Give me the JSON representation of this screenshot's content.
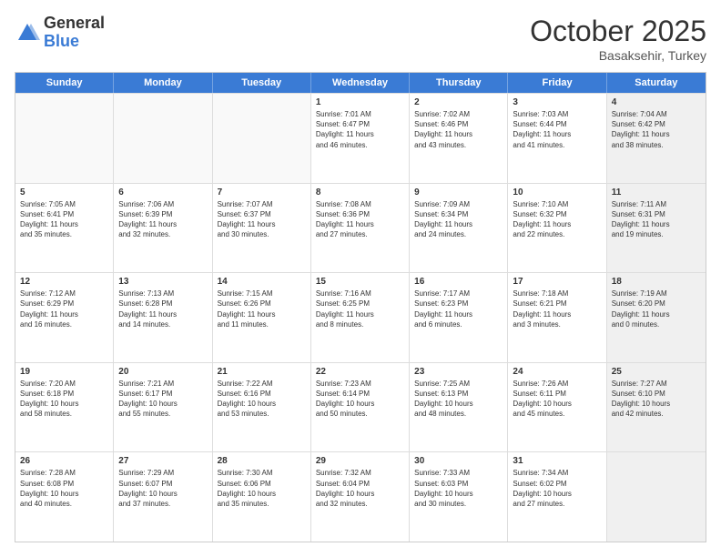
{
  "logo": {
    "general": "General",
    "blue": "Blue"
  },
  "title": {
    "month": "October 2025",
    "location": "Basaksehir, Turkey"
  },
  "header": {
    "days": [
      "Sunday",
      "Monday",
      "Tuesday",
      "Wednesday",
      "Thursday",
      "Friday",
      "Saturday"
    ]
  },
  "rows": [
    [
      {
        "day": "",
        "text": "",
        "empty": true
      },
      {
        "day": "",
        "text": "",
        "empty": true
      },
      {
        "day": "",
        "text": "",
        "empty": true
      },
      {
        "day": "1",
        "text": "Sunrise: 7:01 AM\nSunset: 6:47 PM\nDaylight: 11 hours\nand 46 minutes.",
        "empty": false
      },
      {
        "day": "2",
        "text": "Sunrise: 7:02 AM\nSunset: 6:46 PM\nDaylight: 11 hours\nand 43 minutes.",
        "empty": false
      },
      {
        "day": "3",
        "text": "Sunrise: 7:03 AM\nSunset: 6:44 PM\nDaylight: 11 hours\nand 41 minutes.",
        "empty": false
      },
      {
        "day": "4",
        "text": "Sunrise: 7:04 AM\nSunset: 6:42 PM\nDaylight: 11 hours\nand 38 minutes.",
        "empty": false,
        "shaded": true
      }
    ],
    [
      {
        "day": "5",
        "text": "Sunrise: 7:05 AM\nSunset: 6:41 PM\nDaylight: 11 hours\nand 35 minutes.",
        "empty": false
      },
      {
        "day": "6",
        "text": "Sunrise: 7:06 AM\nSunset: 6:39 PM\nDaylight: 11 hours\nand 32 minutes.",
        "empty": false
      },
      {
        "day": "7",
        "text": "Sunrise: 7:07 AM\nSunset: 6:37 PM\nDaylight: 11 hours\nand 30 minutes.",
        "empty": false
      },
      {
        "day": "8",
        "text": "Sunrise: 7:08 AM\nSunset: 6:36 PM\nDaylight: 11 hours\nand 27 minutes.",
        "empty": false
      },
      {
        "day": "9",
        "text": "Sunrise: 7:09 AM\nSunset: 6:34 PM\nDaylight: 11 hours\nand 24 minutes.",
        "empty": false
      },
      {
        "day": "10",
        "text": "Sunrise: 7:10 AM\nSunset: 6:32 PM\nDaylight: 11 hours\nand 22 minutes.",
        "empty": false
      },
      {
        "day": "11",
        "text": "Sunrise: 7:11 AM\nSunset: 6:31 PM\nDaylight: 11 hours\nand 19 minutes.",
        "empty": false,
        "shaded": true
      }
    ],
    [
      {
        "day": "12",
        "text": "Sunrise: 7:12 AM\nSunset: 6:29 PM\nDaylight: 11 hours\nand 16 minutes.",
        "empty": false
      },
      {
        "day": "13",
        "text": "Sunrise: 7:13 AM\nSunset: 6:28 PM\nDaylight: 11 hours\nand 14 minutes.",
        "empty": false
      },
      {
        "day": "14",
        "text": "Sunrise: 7:15 AM\nSunset: 6:26 PM\nDaylight: 11 hours\nand 11 minutes.",
        "empty": false
      },
      {
        "day": "15",
        "text": "Sunrise: 7:16 AM\nSunset: 6:25 PM\nDaylight: 11 hours\nand 8 minutes.",
        "empty": false
      },
      {
        "day": "16",
        "text": "Sunrise: 7:17 AM\nSunset: 6:23 PM\nDaylight: 11 hours\nand 6 minutes.",
        "empty": false
      },
      {
        "day": "17",
        "text": "Sunrise: 7:18 AM\nSunset: 6:21 PM\nDaylight: 11 hours\nand 3 minutes.",
        "empty": false
      },
      {
        "day": "18",
        "text": "Sunrise: 7:19 AM\nSunset: 6:20 PM\nDaylight: 11 hours\nand 0 minutes.",
        "empty": false,
        "shaded": true
      }
    ],
    [
      {
        "day": "19",
        "text": "Sunrise: 7:20 AM\nSunset: 6:18 PM\nDaylight: 10 hours\nand 58 minutes.",
        "empty": false
      },
      {
        "day": "20",
        "text": "Sunrise: 7:21 AM\nSunset: 6:17 PM\nDaylight: 10 hours\nand 55 minutes.",
        "empty": false
      },
      {
        "day": "21",
        "text": "Sunrise: 7:22 AM\nSunset: 6:16 PM\nDaylight: 10 hours\nand 53 minutes.",
        "empty": false
      },
      {
        "day": "22",
        "text": "Sunrise: 7:23 AM\nSunset: 6:14 PM\nDaylight: 10 hours\nand 50 minutes.",
        "empty": false
      },
      {
        "day": "23",
        "text": "Sunrise: 7:25 AM\nSunset: 6:13 PM\nDaylight: 10 hours\nand 48 minutes.",
        "empty": false
      },
      {
        "day": "24",
        "text": "Sunrise: 7:26 AM\nSunset: 6:11 PM\nDaylight: 10 hours\nand 45 minutes.",
        "empty": false
      },
      {
        "day": "25",
        "text": "Sunrise: 7:27 AM\nSunset: 6:10 PM\nDaylight: 10 hours\nand 42 minutes.",
        "empty": false,
        "shaded": true
      }
    ],
    [
      {
        "day": "26",
        "text": "Sunrise: 7:28 AM\nSunset: 6:08 PM\nDaylight: 10 hours\nand 40 minutes.",
        "empty": false
      },
      {
        "day": "27",
        "text": "Sunrise: 7:29 AM\nSunset: 6:07 PM\nDaylight: 10 hours\nand 37 minutes.",
        "empty": false
      },
      {
        "day": "28",
        "text": "Sunrise: 7:30 AM\nSunset: 6:06 PM\nDaylight: 10 hours\nand 35 minutes.",
        "empty": false
      },
      {
        "day": "29",
        "text": "Sunrise: 7:32 AM\nSunset: 6:04 PM\nDaylight: 10 hours\nand 32 minutes.",
        "empty": false
      },
      {
        "day": "30",
        "text": "Sunrise: 7:33 AM\nSunset: 6:03 PM\nDaylight: 10 hours\nand 30 minutes.",
        "empty": false
      },
      {
        "day": "31",
        "text": "Sunrise: 7:34 AM\nSunset: 6:02 PM\nDaylight: 10 hours\nand 27 minutes.",
        "empty": false
      },
      {
        "day": "",
        "text": "",
        "empty": true,
        "shaded": true
      }
    ]
  ]
}
